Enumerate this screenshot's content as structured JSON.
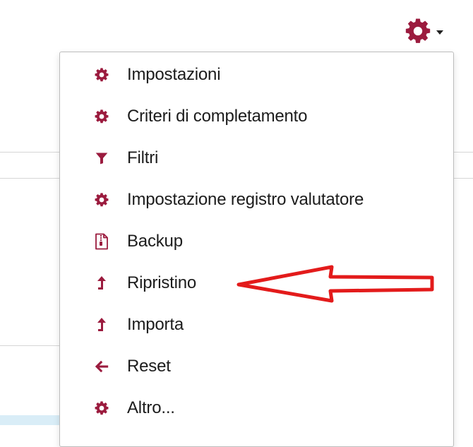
{
  "colors": {
    "accent": "#9b1b3e",
    "annotation": "#e31b1b",
    "text": "#1c1c1c"
  },
  "trigger": {
    "icon": "gear-icon",
    "caret_icon": "caret-down-icon"
  },
  "menu": {
    "items": [
      {
        "label": "Impostazioni",
        "icon": "gear-icon"
      },
      {
        "label": "Criteri di completamento",
        "icon": "gear-icon"
      },
      {
        "label": "Filtri",
        "icon": "filter-icon"
      },
      {
        "label": "Impostazione registro valutatore",
        "icon": "gear-icon"
      },
      {
        "label": "Backup",
        "icon": "file-archive-icon"
      },
      {
        "label": "Ripristino",
        "icon": "level-up-icon"
      },
      {
        "label": "Importa",
        "icon": "level-up-icon"
      },
      {
        "label": "Reset",
        "icon": "arrow-left-icon"
      },
      {
        "label": "Altro...",
        "icon": "gear-icon"
      }
    ]
  },
  "annotation": {
    "icon": "red-arrow-annotation",
    "target": "Ripristino"
  }
}
